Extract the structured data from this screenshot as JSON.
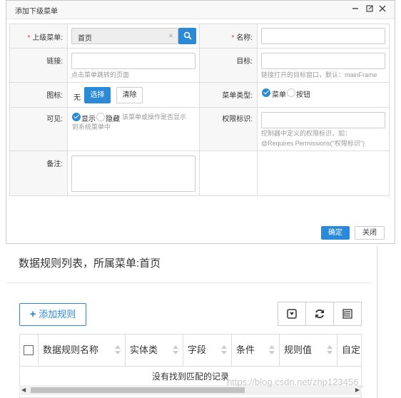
{
  "dialog": {
    "title": "添加下级菜单",
    "controls": [
      "minimize-icon",
      "maximize-icon",
      "close-icon"
    ],
    "fields": {
      "parent_menu": {
        "label": "上级菜单:",
        "required": "*",
        "value": "首页"
      },
      "name": {
        "label": "名称:",
        "required": "*",
        "value": ""
      },
      "link": {
        "label": "链接:",
        "value": "",
        "help": "点击菜单跳转的页面"
      },
      "target": {
        "label": "目标:",
        "value": "",
        "help": "链接打开的目标窗口，默认：mainFrame"
      },
      "icon": {
        "label": "图标:",
        "value": "无",
        "select_label": "选择",
        "clear_label": "清除"
      },
      "menu_type": {
        "label": "菜单类型:",
        "options": [
          "菜单",
          "按钮"
        ],
        "selected": "菜单"
      },
      "visible": {
        "label": "可见:",
        "options": [
          "显示",
          "隐藏"
        ],
        "selected": "显示",
        "help_line1": "该菜单或操作是否显示",
        "help_line2": "到系统菜单中"
      },
      "permission": {
        "label": "权限标识:",
        "value": "",
        "help_line1": "控制器中定义的权限标识，如：",
        "help_line2": "@Requires Permissions(\"权限标识\")"
      },
      "remark": {
        "label": "备注:",
        "value": ""
      }
    },
    "confirm_label": "确定",
    "close_label": "关闭"
  },
  "list": {
    "title": "数据规则列表，所属菜单:首页",
    "add_label": "添加规则",
    "toolbar_icons": [
      "toggle-icon",
      "refresh-icon",
      "columns-icon"
    ],
    "columns": [
      "数据规则名称",
      "实体类",
      "字段",
      "条件",
      "规则值",
      "自定"
    ],
    "empty_message": "没有找到匹配的记录"
  },
  "watermark": "https://blog.csdn.net/zhp123456_",
  "colors": {
    "accent": "#2b8ad8",
    "required": "#e33333"
  }
}
